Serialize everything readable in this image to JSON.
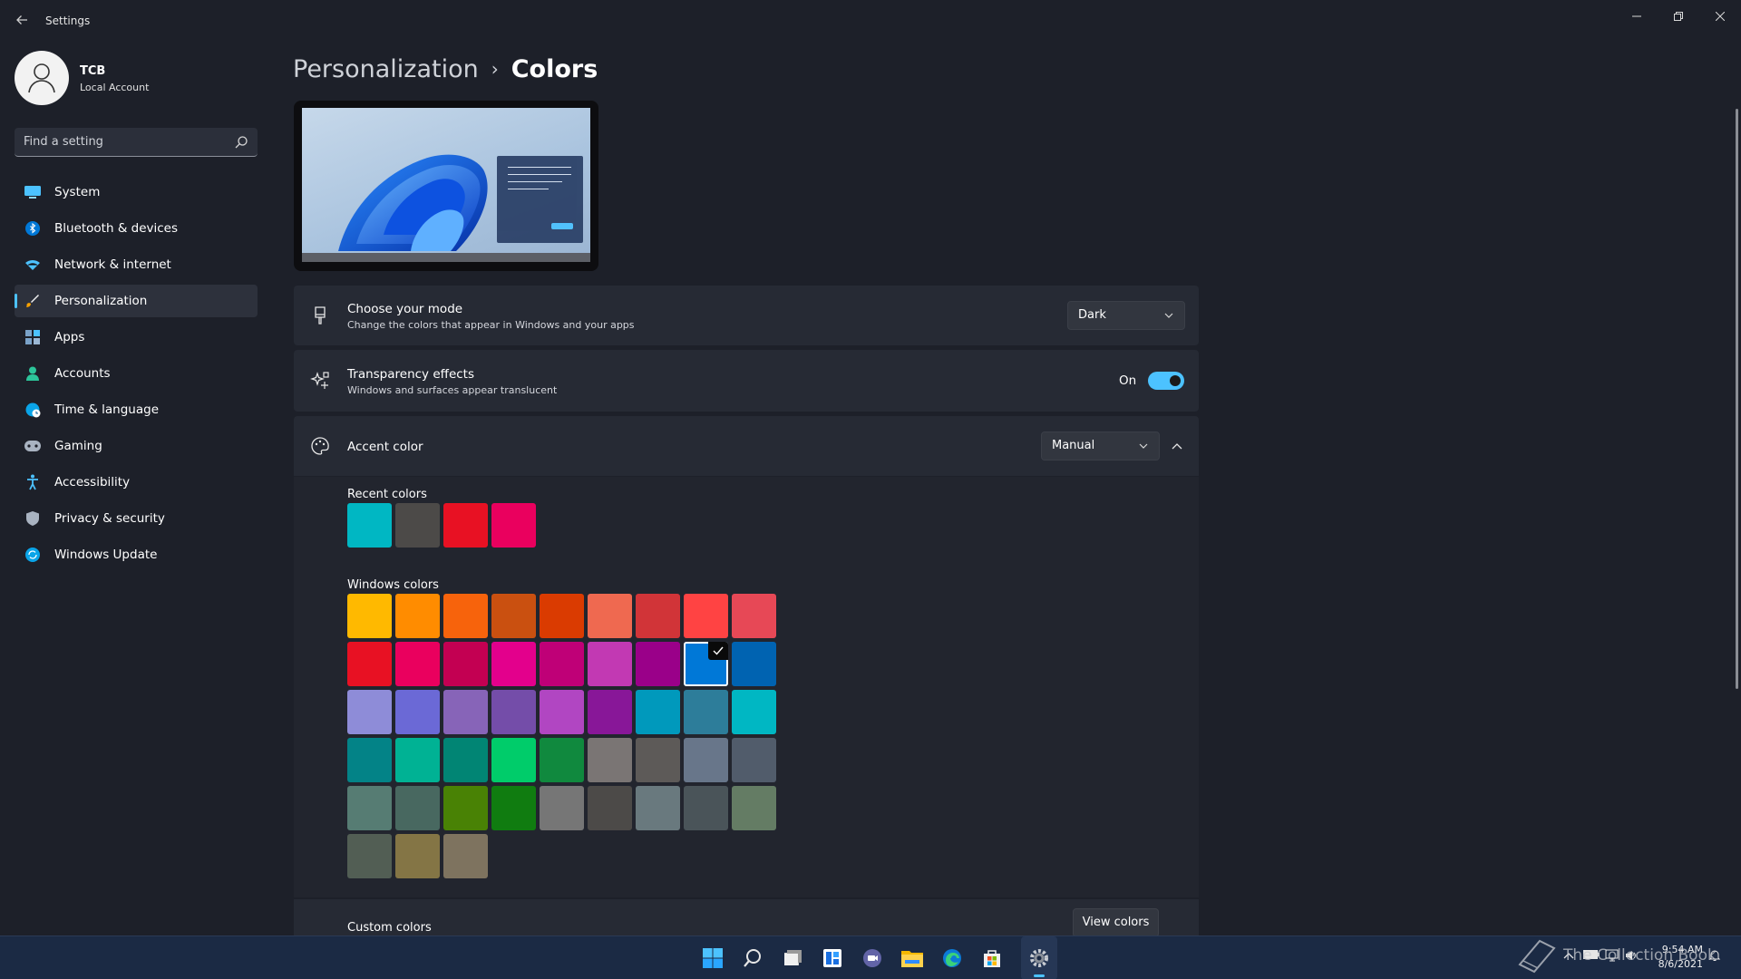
{
  "window": {
    "title": "Settings"
  },
  "profile": {
    "name": "TCB",
    "account_type": "Local Account"
  },
  "search": {
    "placeholder": "Find a setting"
  },
  "nav": {
    "items": [
      {
        "label": "System",
        "icon": "monitor-icon"
      },
      {
        "label": "Bluetooth & devices",
        "icon": "bluetooth-icon"
      },
      {
        "label": "Network & internet",
        "icon": "wifi-icon"
      },
      {
        "label": "Personalization",
        "icon": "brush-icon",
        "active": true
      },
      {
        "label": "Apps",
        "icon": "apps-icon"
      },
      {
        "label": "Accounts",
        "icon": "person-icon"
      },
      {
        "label": "Time & language",
        "icon": "globe-clock-icon"
      },
      {
        "label": "Gaming",
        "icon": "gamepad-icon"
      },
      {
        "label": "Accessibility",
        "icon": "accessibility-icon"
      },
      {
        "label": "Privacy & security",
        "icon": "shield-icon"
      },
      {
        "label": "Windows Update",
        "icon": "update-icon"
      }
    ]
  },
  "breadcrumb": {
    "parent": "Personalization",
    "separator": "›",
    "current": "Colors"
  },
  "mode": {
    "title": "Choose your mode",
    "description": "Change the colors that appear in Windows and your apps",
    "value": "Dark"
  },
  "transparency": {
    "title": "Transparency effects",
    "description": "Windows and surfaces appear translucent",
    "state_label": "On",
    "enabled": true
  },
  "accent": {
    "title": "Accent color",
    "value": "Manual",
    "recent_label": "Recent colors",
    "recent_colors": [
      "#00b7c3",
      "#4c4a48",
      "#e81123",
      "#ea005e"
    ],
    "windows_label": "Windows colors",
    "windows_colors": [
      [
        "#ffb900",
        "#ff8c00",
        "#f7630c",
        "#ca5010",
        "#da3b01",
        "#ef6950",
        "#d13438",
        "#ff4343",
        "#e74856"
      ],
      [
        "#e81123",
        "#ea005e",
        "#c30052",
        "#e3008c",
        "#bf0077",
        "#c239b3",
        "#9a0089",
        "#0078d7",
        "#0063b1"
      ],
      [
        "#8e8cd8",
        "#6b69d6",
        "#8764b8",
        "#744da9",
        "#b146c2",
        "#881798",
        "#0099bc",
        "#2d7d9a",
        "#00b7c3"
      ],
      [
        "#038387",
        "#00b294",
        "#018574",
        "#00cc6a",
        "#10893e",
        "#7a7574",
        "#5d5a58",
        "#68768a",
        "#515c6b"
      ],
      [
        "#567c73",
        "#486860",
        "#498205",
        "#107c10",
        "#767676",
        "#4c4a48",
        "#69797e",
        "#4a5459",
        "#647c64"
      ],
      [
        "#525e54",
        "#847545",
        "#7e735f"
      ]
    ],
    "selected": {
      "row": 1,
      "col": 7
    },
    "custom_label": "Custom colors",
    "view_colors_label": "View colors"
  },
  "taskbar": {
    "icons": [
      "windows-start-icon",
      "search-icon",
      "task-view-icon",
      "widgets-icon",
      "chat-icon",
      "file-explorer-icon",
      "edge-icon",
      "store-icon",
      "settings-icon"
    ],
    "time": "9:54 AM",
    "date": "8/6/2021"
  },
  "watermark": {
    "text": "The Collection Book"
  }
}
